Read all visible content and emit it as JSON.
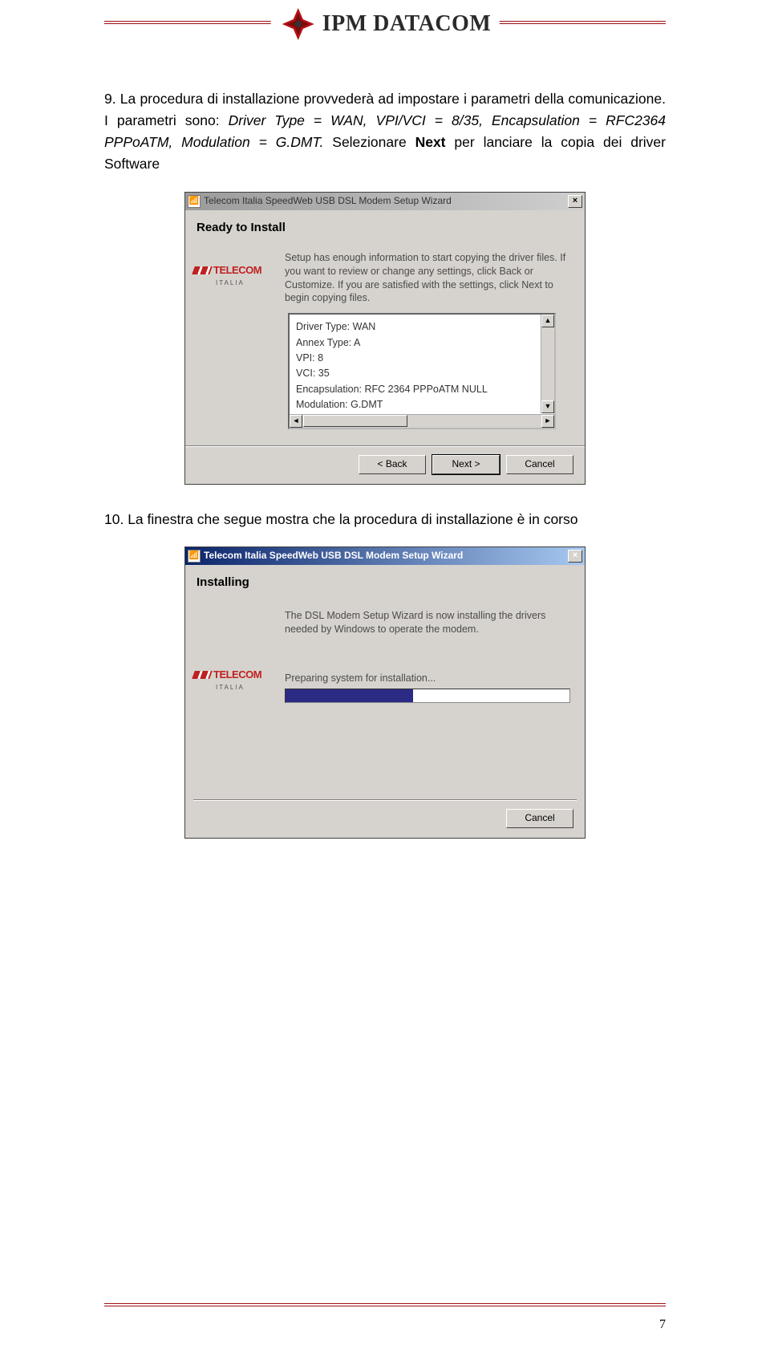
{
  "header": {
    "brand": "IPM DATACOM"
  },
  "para9": {
    "lead": "9.",
    "t1": "La procedura di installazione provvederà ad impostare i parametri della comunicazione. I parametri sono: ",
    "i1": "Driver Type = WAN, VPI/VCI = 8/35, Encapsulation = RFC2364 PPPoATM, Modulation = G.DMT.",
    "t2": " Selezionare ",
    "b1": "Next",
    "t3": "  per lanciare la copia dei driver Software"
  },
  "dlg1": {
    "title": "Telecom Italia SpeedWeb USB DSL Modem Setup Wizard",
    "close": "×",
    "heading": "Ready to Install",
    "desc": "Setup has enough information to start copying the driver files.  If you want to review or change any settings, click Back or Customize.  If you are satisfied with the settings, click Next to begin copying files.",
    "box": {
      "l1": "Driver Type: WAN",
      "l2": "Annex Type: A",
      "l3": "VPI: 8",
      "l4": "VCI: 35",
      "l5": "Encapsulation: RFC 2364 PPPoATM NULL",
      "l6": "Modulation: G.DMT"
    },
    "back": "< Back",
    "next": "Next >",
    "cancel": "Cancel",
    "logo": "TELECOM",
    "logo_sub": "ITALIA",
    "up": "▲",
    "down": "▼",
    "left": "◄",
    "right": "►"
  },
  "para10": {
    "lead": "10.",
    "t1": "La finestra che segue mostra che la procedura di installazione è in corso"
  },
  "dlg2": {
    "title": "Telecom Italia SpeedWeb USB DSL Modem Setup Wizard",
    "close": "×",
    "heading": "Installing",
    "desc": "The DSL Modem Setup Wizard is now installing the drivers needed by Windows to operate the modem.",
    "status": "Preparing system for installation...",
    "cancel": "Cancel",
    "logo": "TELECOM",
    "logo_sub": "ITALIA"
  },
  "page_number": "7"
}
